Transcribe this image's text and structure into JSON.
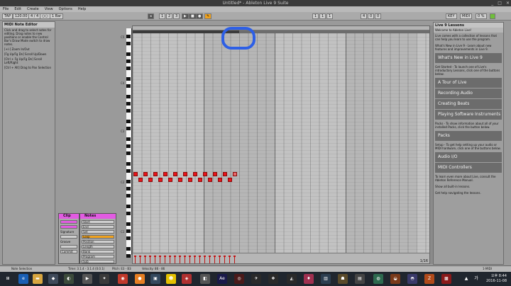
{
  "window": {
    "title": "Untitled* - Ableton Live 9 Suite",
    "controls": [
      "_",
      "□",
      "✕"
    ]
  },
  "menu": [
    "File",
    "Edit",
    "Create",
    "View",
    "Options",
    "Help"
  ],
  "transport": {
    "tap": "TAP",
    "tempo": "120.00",
    "sig": "4 / 4",
    "metro": "○○",
    "quant": "1 Bar",
    "pos1": "1",
    "pos2": "2",
    "pos3": "3",
    "pos4": "1",
    "play": "▶",
    "stop": "■",
    "rec": "●",
    "right_a": "1",
    "right_b": "1",
    "right_c": "1",
    "right_d": "4",
    "right_e": "0",
    "right_f": "0",
    "key": "KEY",
    "midi": "MIDI",
    "cpu": "0 %"
  },
  "info": {
    "title": "MIDI Note Editor",
    "text1": "Click and drag to select notes for editing. Drag notes to new positions or enable the Control Bar's Draw Mode switch to draw notes.",
    "text2": "[+/-] Zoom In/Out",
    "text3": "[Fg Up/Fg Dn] Scroll Up/Down",
    "text4": "[Ctrl + Fg Up/Fg Dn] Scroll Left/Right",
    "text5": "[Ctrl + Alt] Drag to Pan Selection"
  },
  "clip_panel": {
    "title": "Clip",
    "sig_label": "Signature",
    "groove_label": "Groove",
    "commit": "Commit"
  },
  "notes_panel": {
    "title": "Notes",
    "start": "Start",
    "end": "End",
    "set": "Set",
    "loop": "Loop",
    "position": "Position",
    "length": "Length",
    "bank": "Bank",
    "program": "Program",
    "sub": "Sub"
  },
  "octaves": [
    "C5",
    "C4",
    "C3",
    "C2",
    "C1"
  ],
  "editor": {
    "fold": "1/16"
  },
  "chart_data": null,
  "notes": {
    "count": 21
  },
  "help": {
    "title": "Live 9 Lessons",
    "welcome": "Welcome to Ableton Live!",
    "intro": "Live comes with a collection of lessons that can help you learn to use the program.",
    "whatsnew_text": "What's New in Live 9 - Learn about new features and improvements in Live 9.",
    "getstarted_text": "Get Started - To launch one of Live's introductory Lessons, click one of the buttons below.",
    "packs_text": "Packs - To show information about all of your installed Packs, click the button below.",
    "setup_text": "Setup - To get help setting up your audio or MIDI hardware, click one of the buttons below.",
    "footer1": "To learn even more about Live, consult the Ableton Reference Manual.",
    "footer2": "Show all built-in lessons.",
    "footer3": "Get help navigating the lessons.",
    "buttons": {
      "whatsnew": "What's New in Live 9",
      "tour": "A Tour of Live",
      "recording": "Recording Audio",
      "beats": "Creating Beats",
      "instruments": "Playing Software Instruments",
      "packs": "Packs",
      "audioio": "Audio I/O",
      "midicontrollers": "MIDI Controllers"
    }
  },
  "status": {
    "left": "Note Selection",
    "mid1": "Time: 3.1.4 - 3.1.4 (0.0.1)",
    "mid2": "Pitch: E3 - B3",
    "mid3": "Velocity: 86 - 86",
    "right": "1-MIDI"
  },
  "taskbar": {
    "clock_time": "오후 8:44",
    "clock_date": "2016-11-08",
    "lang": "가"
  }
}
